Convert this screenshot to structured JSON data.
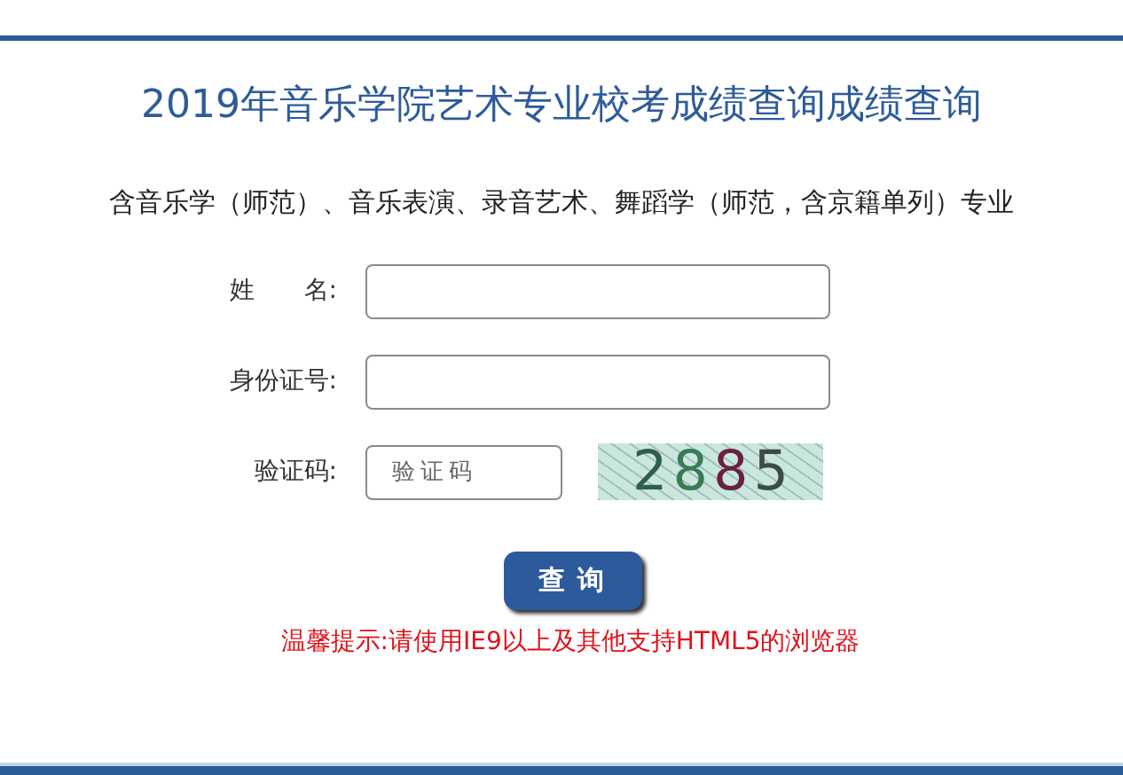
{
  "title": "2019年音乐学院艺术专业校考成绩查询成绩查询",
  "subtitle": "含音乐学（师范）、音乐表演、录音艺术、舞蹈学（师范，含京籍单列）专业",
  "fields": [
    {
      "kind": "text",
      "label": "姓　　名:"
    },
    {
      "kind": "text",
      "label": "身份证号:"
    },
    {
      "kind": "captcha",
      "label": "验证码:",
      "placeholder": "验证码",
      "captcha": [
        {
          "text": "2",
          "color": "#2f5f48"
        },
        {
          "text": "8",
          "color": "#3a7a55"
        },
        {
          "text": "8",
          "color": "#6a2040"
        },
        {
          "text": "5",
          "color": "#3c4a48"
        }
      ]
    }
  ],
  "button": "查 询",
  "notice": "温馨提示:请使用IE9以上及其他支持HTML5的浏览器"
}
